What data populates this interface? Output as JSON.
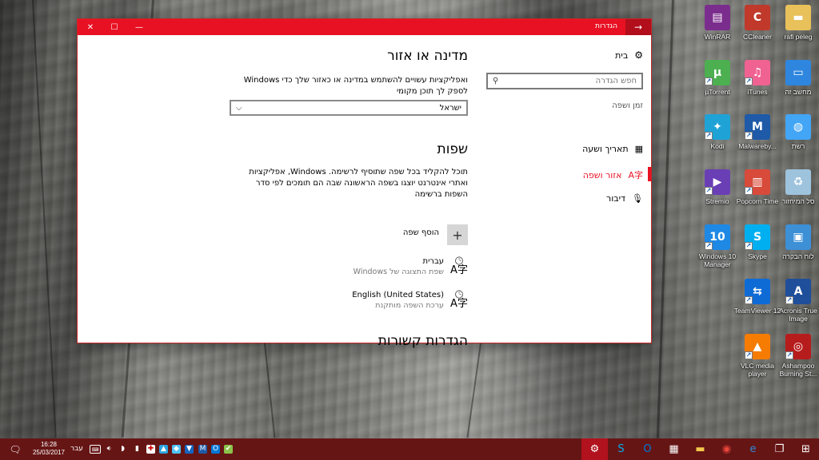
{
  "window": {
    "title": "הגדרות",
    "back_icon": "→",
    "minimize_icon": "—",
    "maximize_icon": "☐",
    "close_icon": "✕",
    "accent_color": "#e81123"
  },
  "sidebar": {
    "home_label": "בית",
    "search_placeholder": "חפש הגדרה",
    "section_label": "זמן ושפה",
    "items": [
      {
        "label": "תאריך ושעה",
        "icon": "calendar-clock-icon",
        "active": false
      },
      {
        "label": "אזור ושפה",
        "icon": "language-region-icon",
        "active": true
      },
      {
        "label": "דיבור",
        "icon": "microphone-icon",
        "active": false
      }
    ]
  },
  "content": {
    "country_heading": "מדינה או אזור",
    "country_description": "ואפליקציות עשויים להשתמש במדינה או כאזור שלך כדי Windows לספק לך תוכן מקומי",
    "country_value": "ישראל",
    "languages_heading": "שפות",
    "languages_description": "תוכל להקליד בכל שפה שתוסיף לרשימה. Windows, אפליקציות ואתרי אינטרנט יוצגו בשפה הראשונה שבה הם תומכים לפי סדר השפות ברשימה",
    "add_language_label": "הוסף שפה",
    "languages": [
      {
        "name": "עברית",
        "sub": "שפת התצוגה של Windows"
      },
      {
        "name": "English (United States)",
        "sub": "ערכת השפה מותקנת"
      }
    ],
    "related_heading": "הגדרות קשורות"
  },
  "desktop_icons": [
    {
      "label": "rafi peleg",
      "icon": "folder-icon",
      "color": "#e8c15a"
    },
    {
      "label": "CCleaner",
      "icon": "ccleaner-icon",
      "color": "#c0392b"
    },
    {
      "label": "WinRAR",
      "icon": "winrar-icon",
      "color": "#7b2d8e"
    },
    {
      "label": "מחשב זה",
      "icon": "computer-icon",
      "color": "#2e86de"
    },
    {
      "label": "iTunes",
      "icon": "itunes-icon",
      "color": "#f06292"
    },
    {
      "label": "µTorrent",
      "icon": "utorrent-icon",
      "color": "#4caf50"
    },
    {
      "label": "רשת",
      "icon": "network-icon",
      "color": "#42a5f5"
    },
    {
      "label": "Malwareby...",
      "icon": "malwarebytes-icon",
      "color": "#1e5aa8"
    },
    {
      "label": "Kodi",
      "icon": "kodi-icon",
      "color": "#1fa3d6"
    },
    {
      "label": "סל המיחזור",
      "icon": "recycle-bin-icon",
      "color": "#9ec3dd"
    },
    {
      "label": "Popcorn Time",
      "icon": "popcorn-icon",
      "color": "#d84a3a"
    },
    {
      "label": "Stremio",
      "icon": "stremio-icon",
      "color": "#6a3fb5"
    },
    {
      "label": "לוח הבקרה",
      "icon": "control-panel-icon",
      "color": "#3d8fd6"
    },
    {
      "label": "Skype",
      "icon": "skype-icon",
      "color": "#00aff0"
    },
    {
      "label": "Windows 10 Manager",
      "icon": "win10-manager-icon",
      "color": "#1e88e5"
    },
    {
      "label": "Acronis True Image",
      "icon": "acronis-icon",
      "color": "#1f4e9b"
    },
    {
      "label": "TeamViewer 12",
      "icon": "teamviewer-icon",
      "color": "#0e6bd6"
    },
    {
      "label": "Ashampoo Burning St...",
      "icon": "ashampoo-icon",
      "color": "#b71c1c"
    },
    {
      "label": "VLC media player",
      "icon": "vlc-icon",
      "color": "#f57c00"
    }
  ],
  "taskbar": {
    "time": "16:28",
    "date": "25/03/2017",
    "language": "עבר",
    "apps": [
      {
        "name": "settings",
        "icon": "gear-icon",
        "glyph": "⚙",
        "active": true
      },
      {
        "name": "skype",
        "icon": "skype-icon",
        "glyph": "S",
        "active": false
      },
      {
        "name": "outlook",
        "icon": "outlook-icon",
        "glyph": "O",
        "active": false
      },
      {
        "name": "store",
        "icon": "store-icon",
        "glyph": "▦",
        "active": false
      },
      {
        "name": "explorer",
        "icon": "folder-icon",
        "glyph": "▬",
        "active": false
      },
      {
        "name": "chrome",
        "icon": "chrome-icon",
        "glyph": "◉",
        "active": false
      },
      {
        "name": "edge",
        "icon": "edge-icon",
        "glyph": "e",
        "active": false
      },
      {
        "name": "task-view",
        "icon": "task-view-icon",
        "glyph": "❐",
        "active": false
      },
      {
        "name": "start",
        "icon": "windows-start-icon",
        "glyph": "⊞",
        "active": false
      }
    ]
  }
}
